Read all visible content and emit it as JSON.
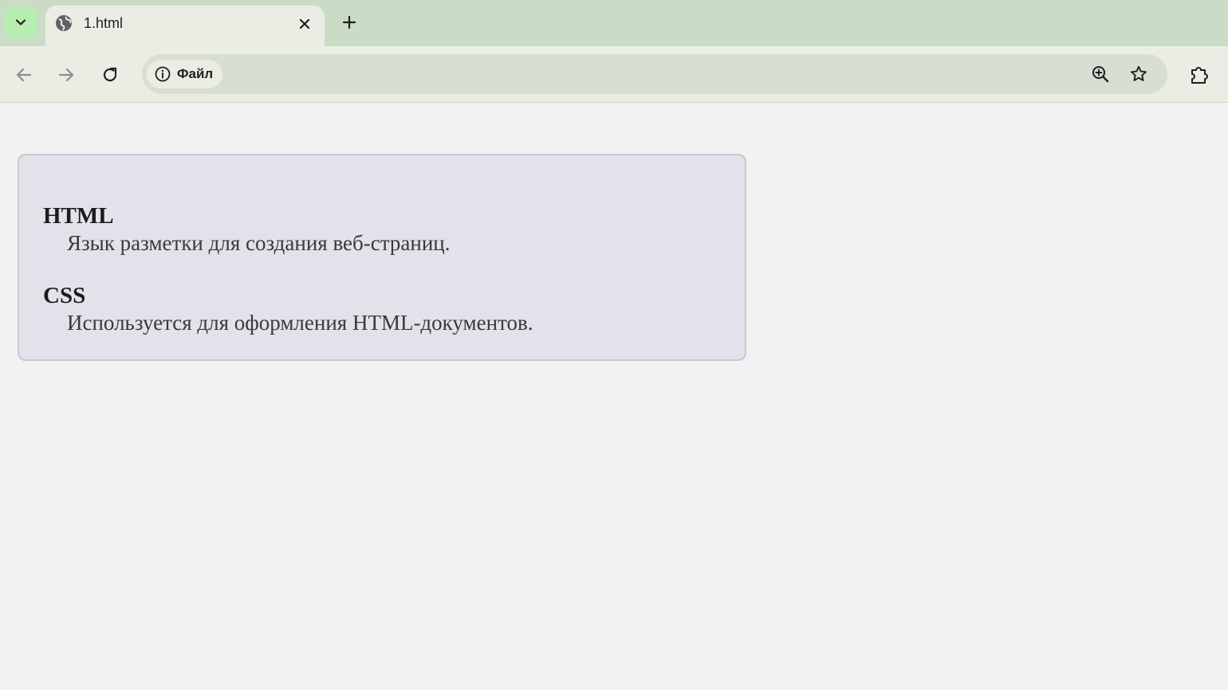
{
  "browser": {
    "tab": {
      "title": "1.html"
    },
    "address_bar": {
      "site_chip_label": "Файл"
    }
  },
  "colors": {
    "tabstrip": "#cadcc6",
    "toolbar": "#ebede4",
    "omnibox": "#d7dfd3",
    "tab_search_button": "#b6eeb2",
    "page_background": "#f2f2f2",
    "card_background": "#e2e2ea",
    "card_border": "#c8c8d0"
  },
  "icons": {
    "tab_search": "chevron-down-icon",
    "favicon": "globe-icon",
    "close_tab": "close-icon",
    "new_tab": "plus-icon",
    "back": "arrow-left-icon",
    "forward": "arrow-right-icon",
    "reload": "reload-icon",
    "site_info": "info-icon",
    "zoom": "zoom-in-icon",
    "bookmark": "star-icon",
    "extensions": "puzzle-icon"
  },
  "page": {
    "definitions": [
      {
        "term": "HTML",
        "description": "Язык разметки для создания веб-страниц."
      },
      {
        "term": "CSS",
        "description": "Используется для оформления HTML-документов."
      }
    ]
  }
}
